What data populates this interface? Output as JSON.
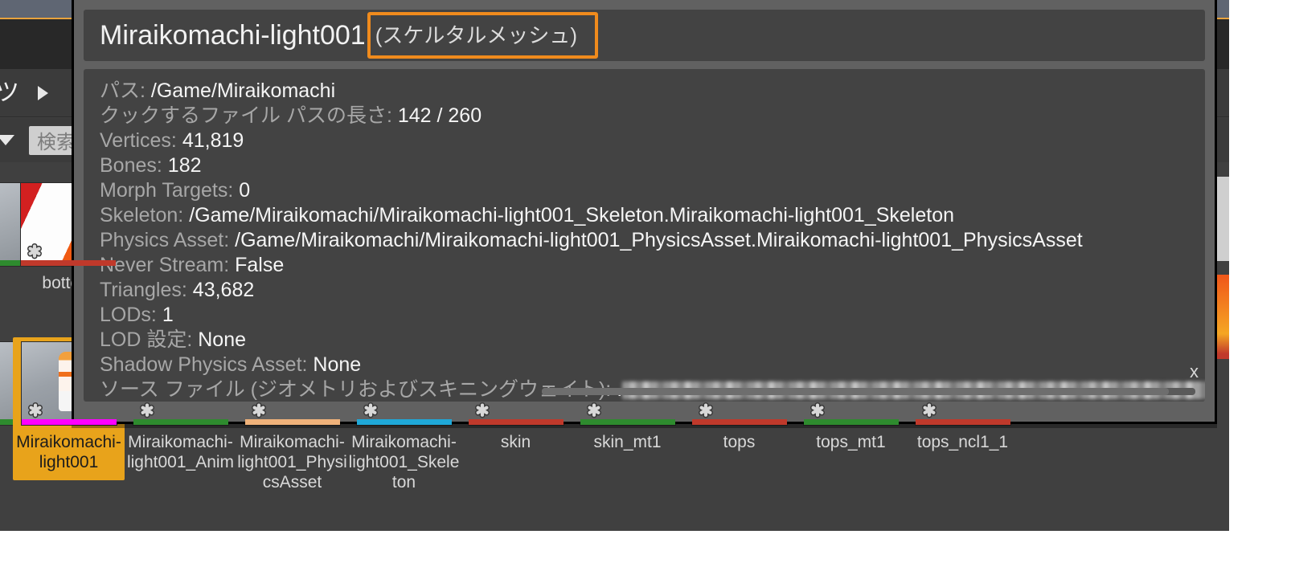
{
  "window": {
    "app": "Unreal Editor Content Browser"
  },
  "breadcrumb": {
    "label": "ツ",
    "arrow_icon": "triangle-right-icon"
  },
  "filter_bar": {
    "caret_icon": "chevron-down-icon",
    "search_placeholder": "検索"
  },
  "tooltip": {
    "asset_name": "Miraikomachi-light001",
    "asset_type": "(スケルタルメッシュ)",
    "highlight_color": "#f08b1d",
    "close_label": "x",
    "rows": [
      {
        "key": "パス:",
        "value": "/Game/Miraikomachi"
      },
      {
        "key": "クックするファイル パスの長さ:",
        "value": "142 / 260"
      },
      {
        "key": "Vertices:",
        "value": "41,819"
      },
      {
        "key": "Bones:",
        "value": "182"
      },
      {
        "key": "Morph Targets:",
        "value": "0"
      },
      {
        "key": "Skeleton:",
        "value": "/Game/Miraikomachi/Miraikomachi-light001_Skeleton.Miraikomachi-light001_Skeleton"
      },
      {
        "key": "Physics Asset:",
        "value": "/Game/Miraikomachi/Miraikomachi-light001_PhysicsAsset.Miraikomachi-light001_PhysicsAsset"
      },
      {
        "key": "Never Stream:",
        "value": "False"
      },
      {
        "key": "Triangles:",
        "value": "43,682"
      },
      {
        "key": "LODs:",
        "value": "1"
      },
      {
        "key": "LOD 設定:",
        "value": "None"
      },
      {
        "key": "Shadow Physics Asset:",
        "value": "None"
      },
      {
        "key": "ソース ファイル (ジオメトリおよびスキニングウェイト):",
        "value": "."
      }
    ]
  },
  "asset_grid": {
    "row1": [
      {
        "label": "bottom",
        "strip_color": "#c0392b",
        "kind": "texture",
        "swatch": "linear-gradient(115deg,#d32020 0 16%,#fdfdfd 16% 58%,#f05a12 58% 76%,#e01f1f 76% 100%)"
      }
    ],
    "row2": [
      {
        "label": "Miraikomachi-light001",
        "strip_color": "#ff00ff",
        "kind": "mesh",
        "selected": true
      },
      {
        "label": "Miraikomachi-light001_Anim",
        "strip_color": "#2e8b2e",
        "kind": "mesh",
        "selected": false
      },
      {
        "label": "Miraikomachi-light001_PhysicsAsset",
        "strip_color": "#f0b27a",
        "kind": "mesh",
        "selected": false
      },
      {
        "label": "Miraikomachi-light001_Skeleton",
        "strip_color": "#1fa8d8",
        "kind": "skeleton",
        "selected": false
      },
      {
        "label": "skin",
        "strip_color": "#c0392b",
        "kind": "texture",
        "selected": false,
        "swatch": "linear-gradient(100deg,#f7b39a 0 38%,#5a1a10 38% 50%,#fbe8d6 50% 100%)"
      },
      {
        "label": "skin_mt1",
        "strip_color": "#2e8b2e",
        "kind": "material",
        "selected": false,
        "swatch": "radial-gradient(circle at 50% 58%, #f2ece4 0 34%, #9aa0a7 34% 100%)"
      },
      {
        "label": "tops",
        "strip_color": "#c0392b",
        "kind": "texture",
        "selected": false,
        "swatch": "linear-gradient(100deg,#fdfdfd 0 42%,#f5a623 42% 62%,#f0561a 62% 84%,#e8821a 84% 100%)"
      },
      {
        "label": "tops_mt1",
        "strip_color": "#2e8b2e",
        "kind": "material",
        "selected": false,
        "swatch": "radial-gradient(circle at 48% 60%, #e8eef2 0 34%, #8f959c 34% 100%)"
      },
      {
        "label": "tops_ncl1_1",
        "strip_color": "#c0392b",
        "kind": "texture",
        "selected": false,
        "swatch": "linear-gradient(100deg,#fdfdfd 0 36%,#f5a623 36% 56%,#f0561a 56% 80%,#e03a12 80% 100%)"
      }
    ]
  }
}
